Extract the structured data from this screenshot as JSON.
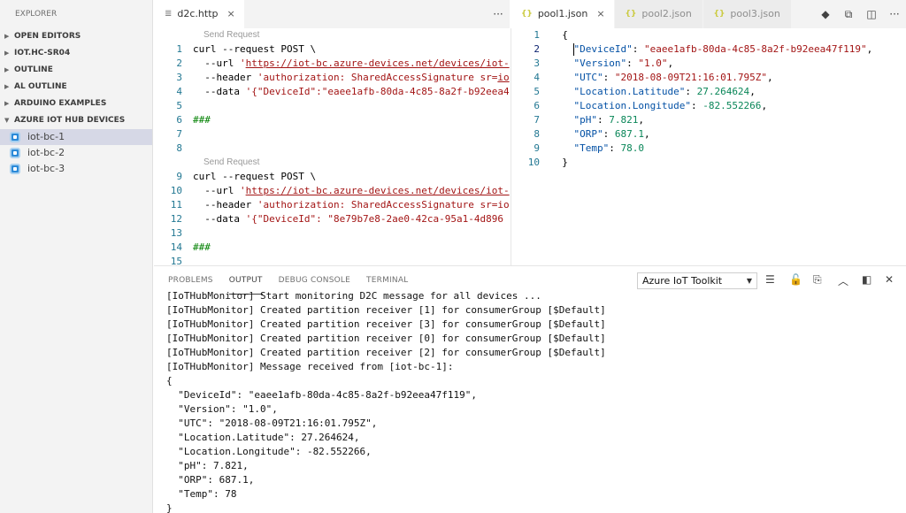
{
  "sidebar": {
    "title": "EXPLORER",
    "sections": [
      {
        "label": "OPEN EDITORS"
      },
      {
        "label": "IOT.HC-SR04"
      },
      {
        "label": "OUTLINE"
      },
      {
        "label": "AL OUTLINE"
      },
      {
        "label": "ARDUINO EXAMPLES"
      },
      {
        "label": "AZURE IOT HUB DEVICES"
      }
    ],
    "devices": [
      "iot-bc-1",
      "iot-bc-2",
      "iot-bc-3"
    ]
  },
  "tabs_left": [
    {
      "label": "d2c.http",
      "icon": "http-file-icon"
    }
  ],
  "tabs_right": [
    {
      "label": "pool1.json",
      "icon": "json-file-icon"
    },
    {
      "label": "pool2.json",
      "icon": "json-file-icon"
    },
    {
      "label": "pool3.json",
      "icon": "json-file-icon"
    }
  ],
  "left_editor": {
    "codelens": "Send Request",
    "lines": [
      {
        "n": "1",
        "segs": [
          [
            "txt",
            "curl --request POST \\"
          ]
        ]
      },
      {
        "n": "2",
        "segs": [
          [
            "txt",
            "  --url "
          ],
          [
            "s-str",
            "'"
          ],
          [
            "s-url",
            "https://iot-bc.azure-devices.net/devices/iot-"
          ]
        ]
      },
      {
        "n": "3",
        "segs": [
          [
            "txt",
            "  --header "
          ],
          [
            "s-str",
            "'authorization: SharedAccessSignature sr="
          ],
          [
            "s-url",
            "io"
          ]
        ]
      },
      {
        "n": "4",
        "segs": [
          [
            "txt",
            "  --data "
          ],
          [
            "s-str",
            "'{\"DeviceId\":\"eaee1afb-80da-4c85-8a2f-b92eea4"
          ]
        ]
      },
      {
        "n": "5",
        "segs": [
          [
            "txt",
            ""
          ]
        ]
      },
      {
        "n": "6",
        "segs": [
          [
            "s-cmt",
            "###"
          ]
        ]
      },
      {
        "n": "7",
        "segs": [
          [
            "txt",
            ""
          ]
        ]
      },
      {
        "n": "8",
        "segs": [
          [
            "txt",
            ""
          ]
        ]
      }
    ],
    "lines2": [
      {
        "n": "9",
        "segs": [
          [
            "txt",
            "curl --request POST \\"
          ]
        ]
      },
      {
        "n": "10",
        "segs": [
          [
            "txt",
            "  --url "
          ],
          [
            "s-str",
            "'"
          ],
          [
            "s-url",
            "https://iot-bc.azure-devices.net/devices/iot-"
          ]
        ]
      },
      {
        "n": "11",
        "segs": [
          [
            "txt",
            "  --header "
          ],
          [
            "s-str",
            "'authorization: SharedAccessSignature sr=io"
          ]
        ]
      },
      {
        "n": "12",
        "segs": [
          [
            "txt",
            "  --data "
          ],
          [
            "s-str",
            "'{\"DeviceId\": \"8e79b7e8-2ae0-42ca-95a1-4d896"
          ]
        ]
      },
      {
        "n": "13",
        "segs": [
          [
            "txt",
            ""
          ]
        ]
      },
      {
        "n": "14",
        "segs": [
          [
            "s-cmt",
            "###"
          ]
        ]
      },
      {
        "n": "15",
        "segs": [
          [
            "txt",
            ""
          ]
        ]
      }
    ]
  },
  "right_editor": {
    "lines": [
      {
        "n": "1",
        "segs": [
          [
            "txt",
            "  {"
          ]
        ]
      },
      {
        "n": "2",
        "cur": true,
        "segs": [
          [
            "s-key",
            "    \"DeviceId\""
          ],
          [
            "txt",
            ": "
          ],
          [
            "s-str",
            "\"eaee1afb-80da-4c85-8a2f-b92eea47f119\""
          ],
          [
            "txt",
            ","
          ]
        ]
      },
      {
        "n": "3",
        "segs": [
          [
            "s-key",
            "    \"Version\""
          ],
          [
            "txt",
            ": "
          ],
          [
            "s-str",
            "\"1.0\""
          ],
          [
            "txt",
            ","
          ]
        ]
      },
      {
        "n": "4",
        "segs": [
          [
            "s-key",
            "    \"UTC\""
          ],
          [
            "txt",
            ": "
          ],
          [
            "s-str",
            "\"2018-08-09T21:16:01.795Z\""
          ],
          [
            "txt",
            ","
          ]
        ]
      },
      {
        "n": "5",
        "segs": [
          [
            "s-key",
            "    \"Location.Latitude\""
          ],
          [
            "txt",
            ": "
          ],
          [
            "s-num",
            "27.264624"
          ],
          [
            "txt",
            ","
          ]
        ]
      },
      {
        "n": "6",
        "segs": [
          [
            "s-key",
            "    \"Location.Longitude\""
          ],
          [
            "txt",
            ": "
          ],
          [
            "s-num",
            "-82.552266"
          ],
          [
            "txt",
            ","
          ]
        ]
      },
      {
        "n": "7",
        "segs": [
          [
            "s-key",
            "    \"pH\""
          ],
          [
            "txt",
            ": "
          ],
          [
            "s-num",
            "7.821"
          ],
          [
            "txt",
            ","
          ]
        ]
      },
      {
        "n": "8",
        "segs": [
          [
            "s-key",
            "    \"ORP\""
          ],
          [
            "txt",
            ": "
          ],
          [
            "s-num",
            "687.1"
          ],
          [
            "txt",
            ","
          ]
        ]
      },
      {
        "n": "9",
        "segs": [
          [
            "s-key",
            "    \"Temp\""
          ],
          [
            "txt",
            ": "
          ],
          [
            "s-num",
            "78.0"
          ]
        ]
      },
      {
        "n": "10",
        "segs": [
          [
            "txt",
            "  }"
          ]
        ]
      }
    ]
  },
  "panel": {
    "tabs": [
      "PROBLEMS",
      "OUTPUT",
      "DEBUG CONSOLE",
      "TERMINAL"
    ],
    "active_tab": "OUTPUT",
    "channel": "Azure IoT Toolkit",
    "output_lines": [
      "[IoTHubMonitor] Start monitoring D2C message for all devices ...",
      "[IoTHubMonitor] Created partition receiver [1] for consumerGroup [$Default]",
      "[IoTHubMonitor] Created partition receiver [3] for consumerGroup [$Default]",
      "[IoTHubMonitor] Created partition receiver [0] for consumerGroup [$Default]",
      "[IoTHubMonitor] Created partition receiver [2] for consumerGroup [$Default]",
      "[IoTHubMonitor] Message received from [iot-bc-1]:",
      "{",
      "  \"DeviceId\": \"eaee1afb-80da-4c85-8a2f-b92eea47f119\",",
      "  \"Version\": \"1.0\",",
      "  \"UTC\": \"2018-08-09T21:16:01.795Z\",",
      "  \"Location.Latitude\": 27.264624,",
      "  \"Location.Longitude\": -82.552266,",
      "  \"pH\": 7.821,",
      "  \"ORP\": 687.1,",
      "  \"Temp\": 78",
      "}"
    ]
  }
}
